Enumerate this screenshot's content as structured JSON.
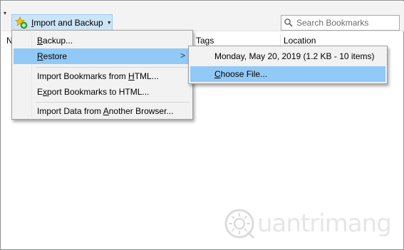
{
  "toolbar": {
    "organize_caret": "▾",
    "import_backup_label": "Import and Backup",
    "search_placeholder": "Search Bookmarks"
  },
  "columns": {
    "name_fragment": "N",
    "tags": "Tags",
    "location": "Location"
  },
  "import_menu": {
    "items": [
      {
        "pre": "",
        "ul": "B",
        "post": "ackup..."
      },
      {
        "pre": "",
        "ul": "R",
        "post": "estore"
      },
      {
        "pre": "Import Bookmarks from ",
        "ul": "H",
        "post": "TML..."
      },
      {
        "pre": "E",
        "ul": "x",
        "post": "port Bookmarks to HTML..."
      },
      {
        "pre": "Import Data from ",
        "ul": "A",
        "post": "nother Browser..."
      }
    ],
    "submenu_arrow": ">"
  },
  "restore_menu": {
    "backup_entry": "Monday, May 20, 2019 (1.2 KB - 10 items)",
    "choose_file": {
      "pre": "",
      "ul": "C",
      "post": "hoose File..."
    }
  },
  "watermark": {
    "text": "uantrimang"
  },
  "colors": {
    "highlight": "#91c9f7",
    "button_bg": "#cce4f7",
    "menu_bg": "#f2f2f2"
  }
}
